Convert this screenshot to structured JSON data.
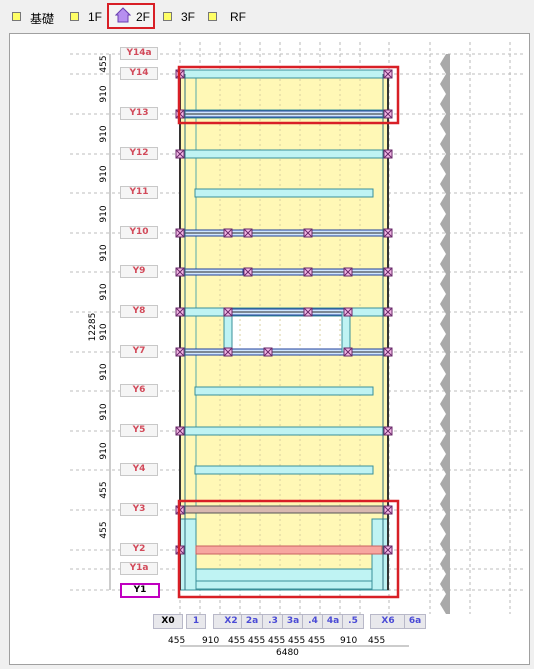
{
  "tabs": [
    {
      "label": "基礎"
    },
    {
      "label": "1F"
    },
    {
      "label": "2F",
      "active": true
    },
    {
      "label": "3F"
    },
    {
      "label": "RF"
    }
  ],
  "grid_y": [
    {
      "label": "Y14a"
    },
    {
      "label": "Y14"
    },
    {
      "label": "Y13"
    },
    {
      "label": "Y12"
    },
    {
      "label": "Y11"
    },
    {
      "label": "Y10"
    },
    {
      "label": "Y9"
    },
    {
      "label": "Y8"
    },
    {
      "label": "Y7"
    },
    {
      "label": "Y6"
    },
    {
      "label": "Y5"
    },
    {
      "label": "Y4"
    },
    {
      "label": "Y3"
    },
    {
      "label": "Y2"
    },
    {
      "label": "Y1a"
    },
    {
      "label": "Y1",
      "active": true
    }
  ],
  "y_dims": [
    "455",
    "910",
    "910",
    "910",
    "910",
    "910",
    "910",
    "910",
    "910",
    "910",
    "910",
    "455",
    "455"
  ],
  "y_total": "12285",
  "grid_x": [
    "X0",
    "1",
    "X2",
    "2a",
    ".3",
    "3a",
    ".4",
    "4a",
    ".5",
    "X6",
    "6a"
  ],
  "x_dims": [
    "455",
    "910",
    "455",
    "455",
    "455",
    "455",
    "455",
    "910",
    "455"
  ],
  "x_total": "6480",
  "colors": {
    "floor": "#fff8b6",
    "beam": "#bff3f3",
    "beam_edge": "#3a8f99",
    "highlight": "#d81f26",
    "pink": "#f7a6a0",
    "joint": "#f3b6e6"
  }
}
